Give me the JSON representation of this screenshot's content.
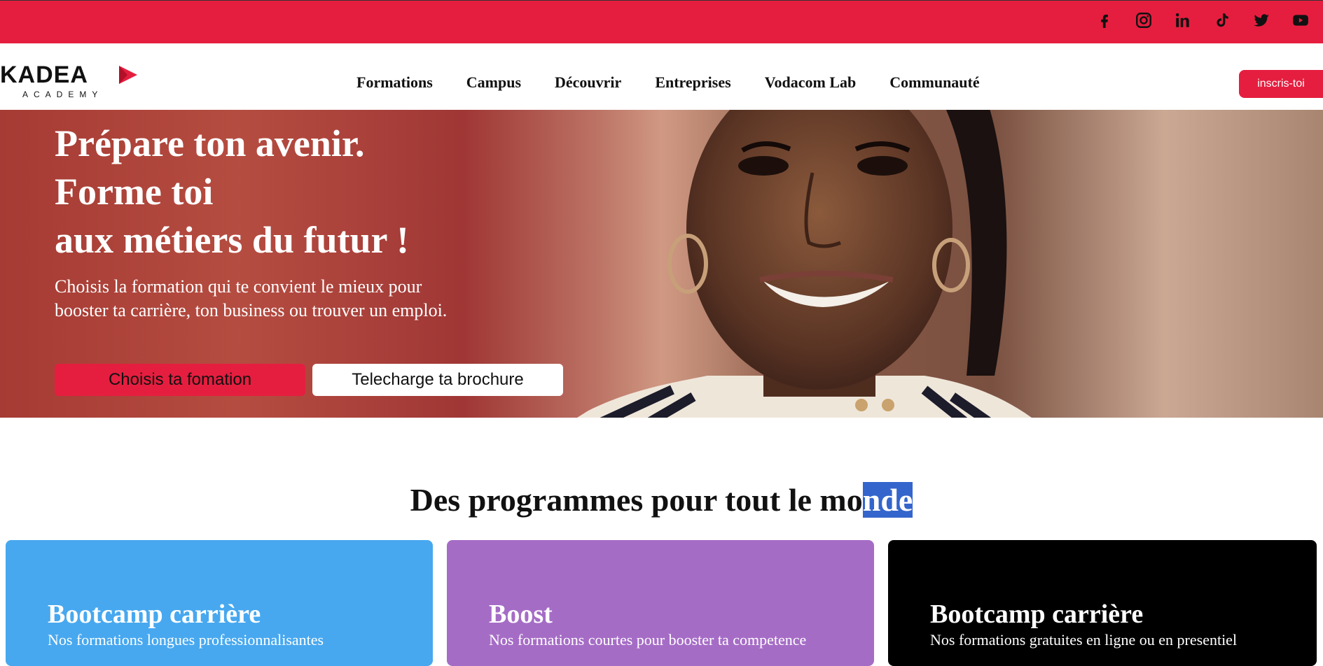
{
  "colors": {
    "brand_red": "#e51e3f",
    "blue": "#47a8ef",
    "purple": "#a56cc6",
    "black": "#000000",
    "selection": "#3465cc"
  },
  "social": [
    {
      "name": "facebook-icon"
    },
    {
      "name": "instagram-icon"
    },
    {
      "name": "linkedin-icon"
    },
    {
      "name": "tiktok-icon"
    },
    {
      "name": "twitter-icon"
    },
    {
      "name": "youtube-icon"
    }
  ],
  "logo": {
    "word": "KADEA",
    "sub": "ACADEMY"
  },
  "menu": [
    "Formations",
    "Campus",
    "Découvrir",
    "Entreprises",
    "Vodacom Lab",
    "Communauté"
  ],
  "signup_label": "inscris-toi",
  "hero": {
    "title_lines": [
      "Prépare ton avenir.",
      "Forme toi",
      "aux métiers du futur !"
    ],
    "subtitle_lines": [
      "Choisis la formation qui te convient le mieux pour",
      "booster ta carrière, ton business ou trouver un emploi."
    ],
    "primary_btn": "Choisis ta fomation",
    "secondary_btn": "Telecharge ta brochure"
  },
  "programs": {
    "title_plain": "Des programmes pour tout le mo",
    "title_selected": "nde",
    "cards": [
      {
        "title": "Bootcamp carrière",
        "desc": "Nos formations longues professionnalisantes"
      },
      {
        "title": "Boost",
        "desc": "Nos formations courtes pour booster ta competence"
      },
      {
        "title": "Bootcamp carrière",
        "desc": "Nos formations gratuites en ligne ou en presentiel"
      }
    ]
  }
}
